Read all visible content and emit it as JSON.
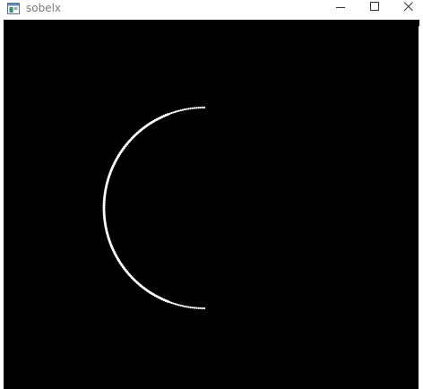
{
  "window": {
    "title": "sobelx",
    "icon": "opencv-window-icon",
    "controls": {
      "minimize_icon": "minimize-icon",
      "maximize_icon": "maximize-icon",
      "close_icon": "close-icon"
    }
  },
  "image_view": {
    "background_color": "#000000",
    "edge_color": "#ffffff",
    "content": "arc"
  },
  "colors": {
    "titlebar_bg": "#ffffff",
    "title_text": "#7a7a7a"
  }
}
